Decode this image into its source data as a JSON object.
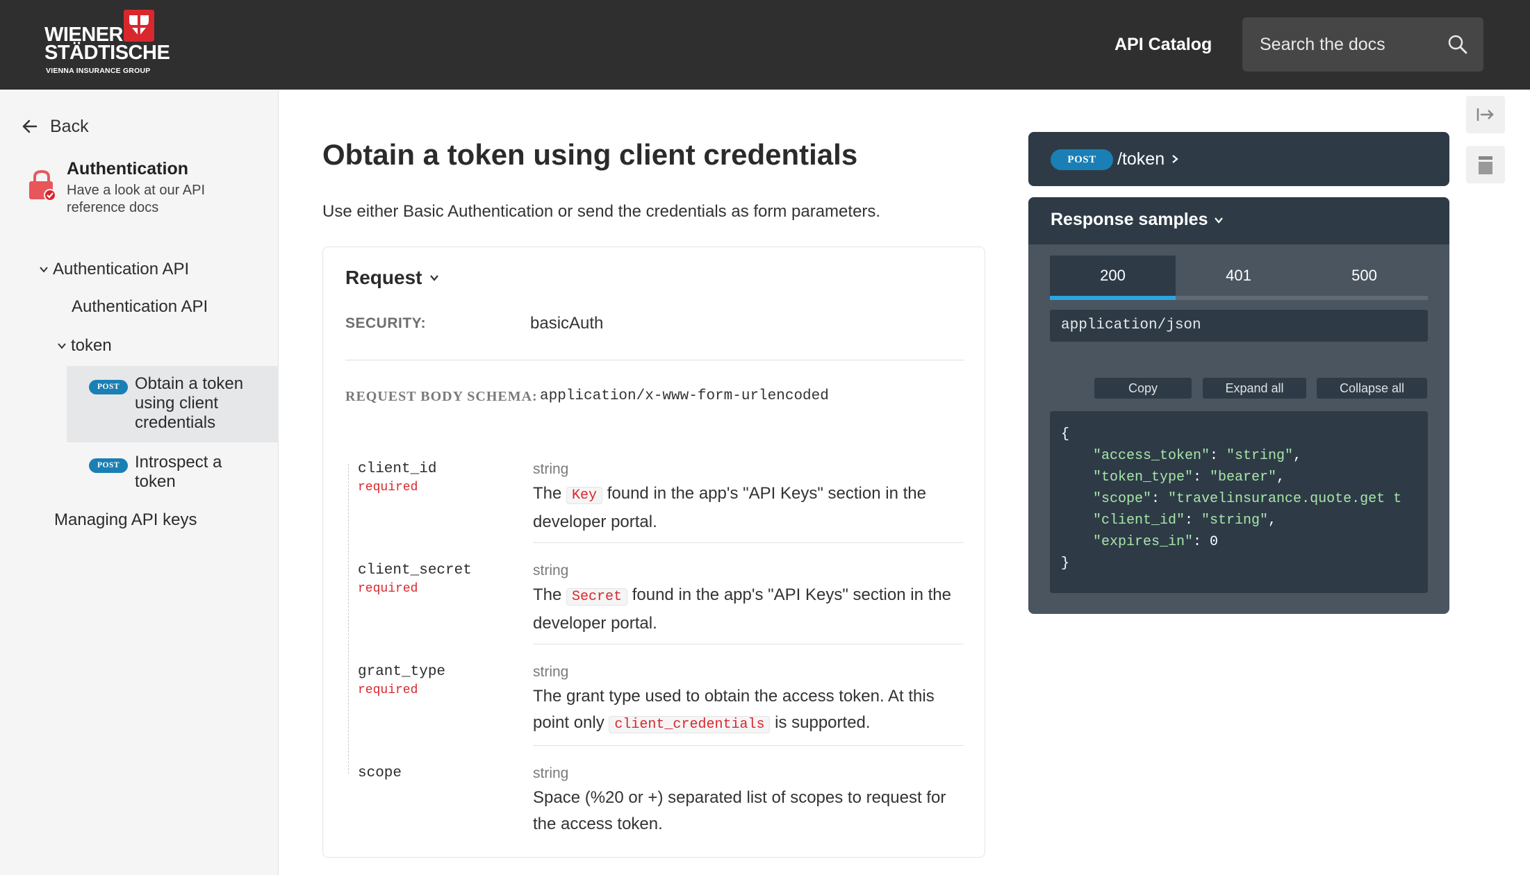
{
  "header": {
    "logo_line1": "WIENER",
    "logo_line2": "STÄDTISCHE",
    "logo_sub": "VIENNA INSURANCE GROUP",
    "nav_catalog": "API Catalog",
    "search_placeholder": "Search the docs",
    "bg_color": "#2f2f2f"
  },
  "sidebar": {
    "back_label": "Back",
    "section_title": "Authentication",
    "section_desc": "Have a look at our API reference docs",
    "items": [
      {
        "label": "Authentication API"
      },
      {
        "label": "Authentication API"
      },
      {
        "label": "token"
      },
      {
        "label": "Managing API keys"
      }
    ],
    "endpoints": [
      {
        "method": "POST",
        "label": "Obtain a token using client credentials",
        "active": true
      },
      {
        "method": "POST",
        "label": "Introspect a token",
        "active": false
      }
    ]
  },
  "main": {
    "title": "Obtain a token using client credentials",
    "description": "Use either Basic Authentication or send the credentials as form parameters.",
    "request": {
      "title": "Request",
      "security_label": "SECURITY:",
      "security_value": "basicAuth",
      "body_schema_label": "REQUEST BODY SCHEMA:",
      "body_schema_value": "application/x-www-form-urlencoded",
      "fields": [
        {
          "name": "client_id",
          "required": "required",
          "type": "string",
          "desc_before": "The",
          "code": "Key",
          "desc_after": "found in the app's \"API Keys\" section in the developer portal."
        },
        {
          "name": "client_secret",
          "required": "required",
          "type": "string",
          "desc_before": "The",
          "code": "Secret",
          "desc_after": "found in the app's \"API Keys\" section in the developer portal."
        },
        {
          "name": "grant_type",
          "required": "required",
          "type": "string",
          "desc_before": "The grant type used to obtain the access token. At this point only",
          "code": "client_credentials",
          "desc_after": "is supported."
        },
        {
          "name": "scope",
          "required": "",
          "type": "string",
          "desc_before": "Space (%20 or +) separated list of scopes to request for the access token.",
          "code": "",
          "desc_after": ""
        }
      ]
    }
  },
  "panel": {
    "method": "POST",
    "path": "/token",
    "samples_title": "Response samples",
    "tabs": [
      "200",
      "401",
      "500"
    ],
    "content_type": "application/json",
    "buttons": {
      "copy": "Copy",
      "expand": "Expand all",
      "collapse": "Collapse all"
    },
    "code": {
      "open": "{",
      "close": "}",
      "lines": [
        {
          "key": "\"access_token\"",
          "value": "\"string\"",
          "trail": ","
        },
        {
          "key": "\"token_type\"",
          "value": "\"bearer\"",
          "trail": ","
        },
        {
          "key": "\"scope\"",
          "value": "\"travelinsurance.quote.get t",
          "trail": ""
        },
        {
          "key": "\"client_id\"",
          "value": "\"string\"",
          "trail": ","
        },
        {
          "key": "\"expires_in\"",
          "value": "0",
          "trail": ""
        }
      ]
    },
    "accent_color": "#2aa5e0",
    "post_color": "#1a7fb5"
  }
}
